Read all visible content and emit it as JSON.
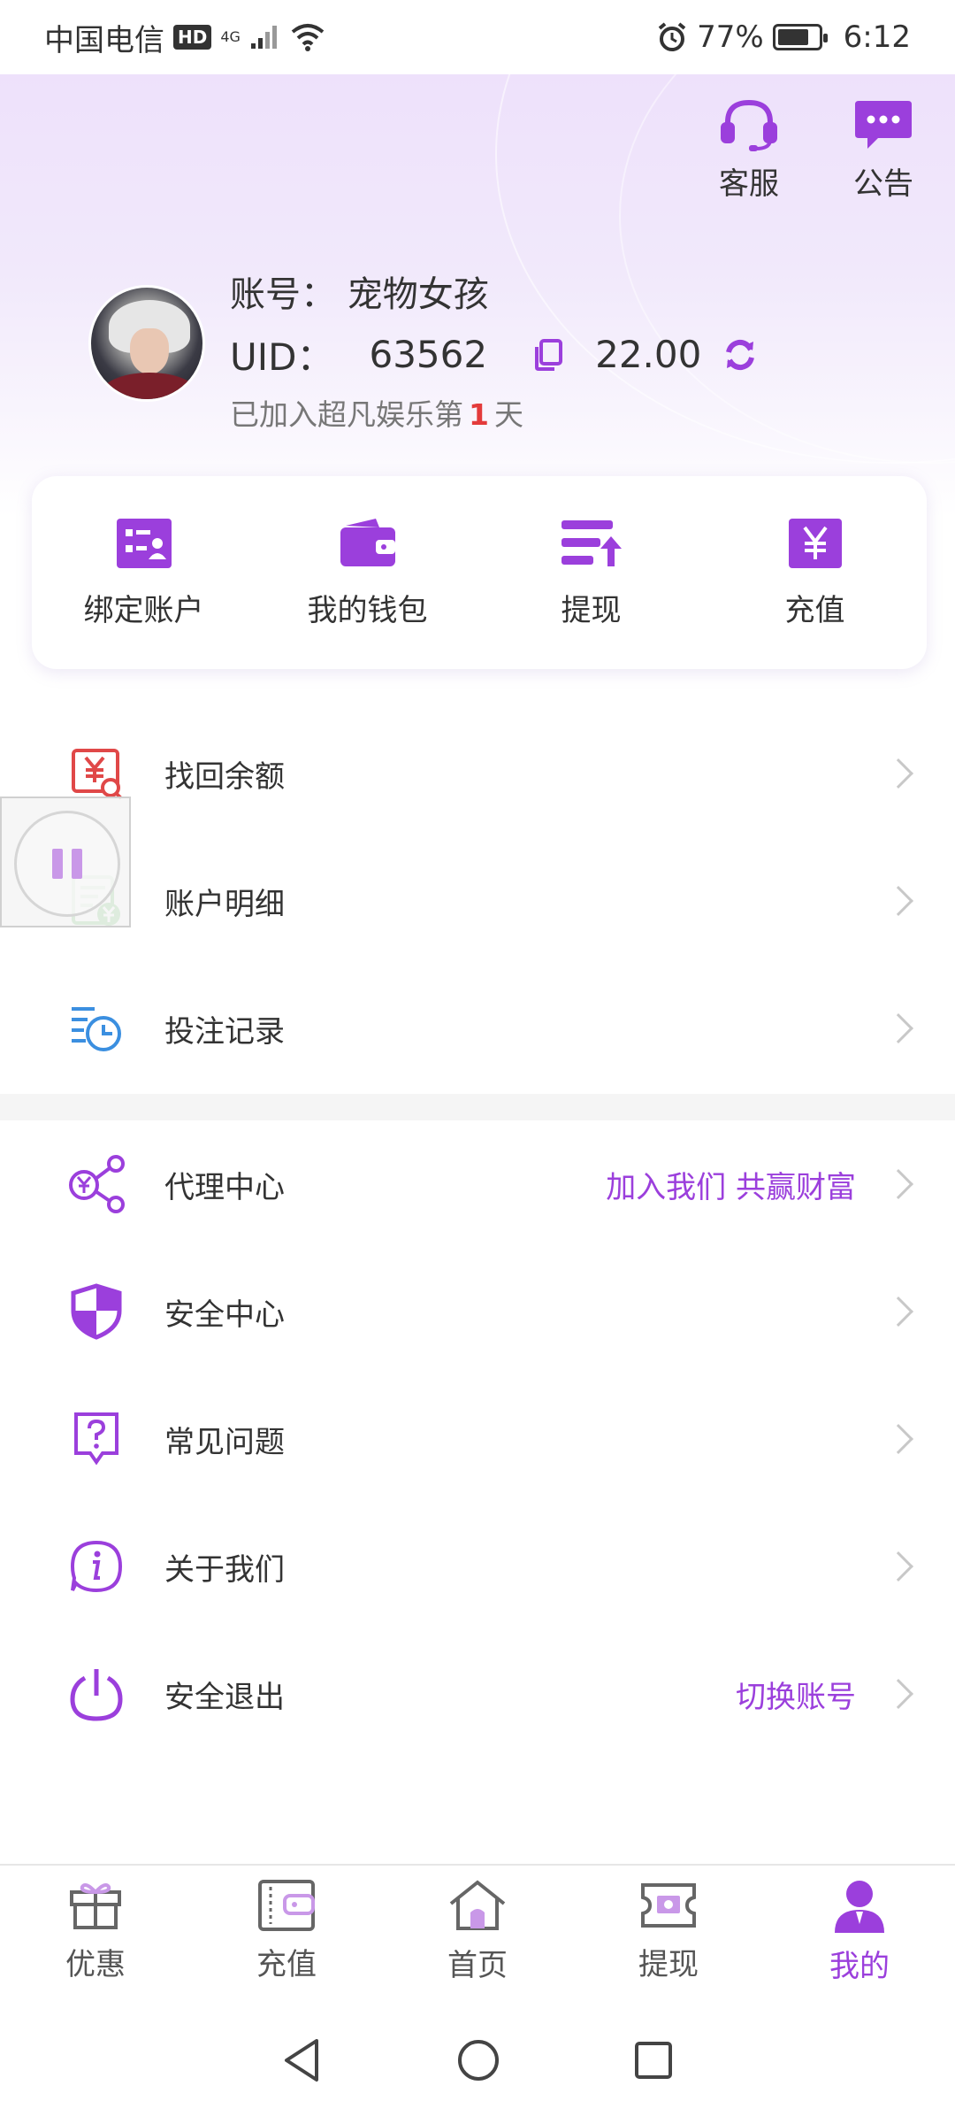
{
  "status_bar": {
    "carrier": "中国电信",
    "hd": "HD",
    "network": "4G",
    "battery": "77%",
    "battery_level": 0.77,
    "time": "6:12"
  },
  "header": {
    "service_label": "客服",
    "notice_label": "公告"
  },
  "profile": {
    "account_label": "账号：",
    "account_name": "宠物女孩",
    "uid_label": "UID：",
    "uid": "63562",
    "balance": "22.00",
    "joined_prefix": "已加入超凡娱乐第",
    "joined_days": "1",
    "joined_suffix": "天"
  },
  "quick_actions": [
    {
      "label": "绑定账户",
      "icon": "bind-account-icon"
    },
    {
      "label": "我的钱包",
      "icon": "wallet-icon"
    },
    {
      "label": "提现",
      "icon": "withdraw-icon"
    },
    {
      "label": "充值",
      "icon": "recharge-yuan-icon"
    }
  ],
  "menu_group_1": [
    {
      "label": "找回余额",
      "icon": "recover-balance-icon"
    },
    {
      "label": "账户明细",
      "icon": "account-details-icon"
    },
    {
      "label": "投注记录",
      "icon": "bet-record-icon"
    }
  ],
  "menu_group_2": [
    {
      "label": "代理中心",
      "extra": "加入我们 共赢财富",
      "icon": "agent-share-icon"
    },
    {
      "label": "安全中心",
      "extra": "",
      "icon": "shield-icon"
    },
    {
      "label": "常见问题",
      "extra": "",
      "icon": "question-icon"
    },
    {
      "label": "关于我们",
      "extra": "",
      "icon": "info-icon"
    },
    {
      "label": "安全退出",
      "extra": "切换账号",
      "icon": "power-icon"
    }
  ],
  "tab_bar": [
    {
      "label": "优惠",
      "icon": "gift-icon",
      "active": false
    },
    {
      "label": "充值",
      "icon": "card-wallet-icon",
      "active": false
    },
    {
      "label": "首页",
      "icon": "home-icon",
      "active": false
    },
    {
      "label": "提现",
      "icon": "cash-ticket-icon",
      "active": false
    },
    {
      "label": "我的",
      "icon": "user-icon",
      "active": true
    }
  ],
  "colors": {
    "accent": "#9b3fdc",
    "red": "#e33b3b",
    "green": "#5cb85c",
    "blue": "#3b8fe0"
  }
}
